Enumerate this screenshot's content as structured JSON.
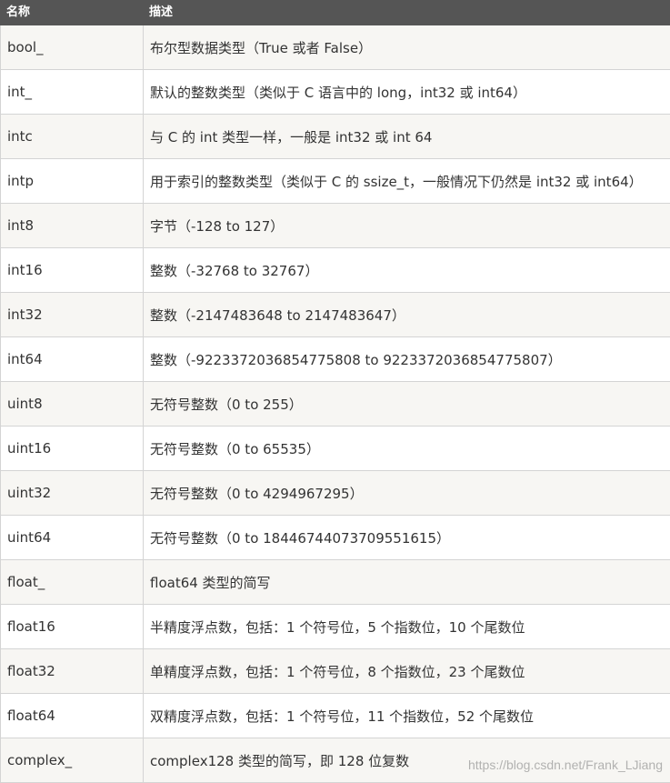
{
  "header": {
    "name_label": "名称",
    "desc_label": "描述"
  },
  "rows": [
    {
      "name": "bool_",
      "desc": "布尔型数据类型（True 或者 False）"
    },
    {
      "name": "int_",
      "desc": "默认的整数类型（类似于 C 语言中的 long，int32 或 int64）"
    },
    {
      "name": "intc",
      "desc": "与 C 的 int 类型一样，一般是 int32 或 int 64"
    },
    {
      "name": "intp",
      "desc": "用于索引的整数类型（类似于 C 的 ssize_t，一般情况下仍然是 int32 或 int64）"
    },
    {
      "name": "int8",
      "desc": "字节（-128 to 127）"
    },
    {
      "name": "int16",
      "desc": "整数（-32768 to 32767）"
    },
    {
      "name": "int32",
      "desc": "整数（-2147483648 to 2147483647）"
    },
    {
      "name": "int64",
      "desc": "整数（-9223372036854775808 to 9223372036854775807）"
    },
    {
      "name": "uint8",
      "desc": "无符号整数（0 to 255）"
    },
    {
      "name": "uint16",
      "desc": "无符号整数（0 to 65535）"
    },
    {
      "name": "uint32",
      "desc": "无符号整数（0 to 4294967295）"
    },
    {
      "name": "uint64",
      "desc": "无符号整数（0 to 18446744073709551615）"
    },
    {
      "name": "float_",
      "desc": "float64 类型的简写"
    },
    {
      "name": "float16",
      "desc": "半精度浮点数，包括：1 个符号位，5 个指数位，10 个尾数位"
    },
    {
      "name": "float32",
      "desc": "单精度浮点数，包括：1 个符号位，8 个指数位，23 个尾数位"
    },
    {
      "name": "float64",
      "desc": "双精度浮点数，包括：1 个符号位，11 个指数位，52 个尾数位"
    },
    {
      "name": "complex_",
      "desc": "complex128 类型的简写，即 128 位复数"
    }
  ],
  "watermark": "https://blog.csdn.net/Frank_LJiang"
}
